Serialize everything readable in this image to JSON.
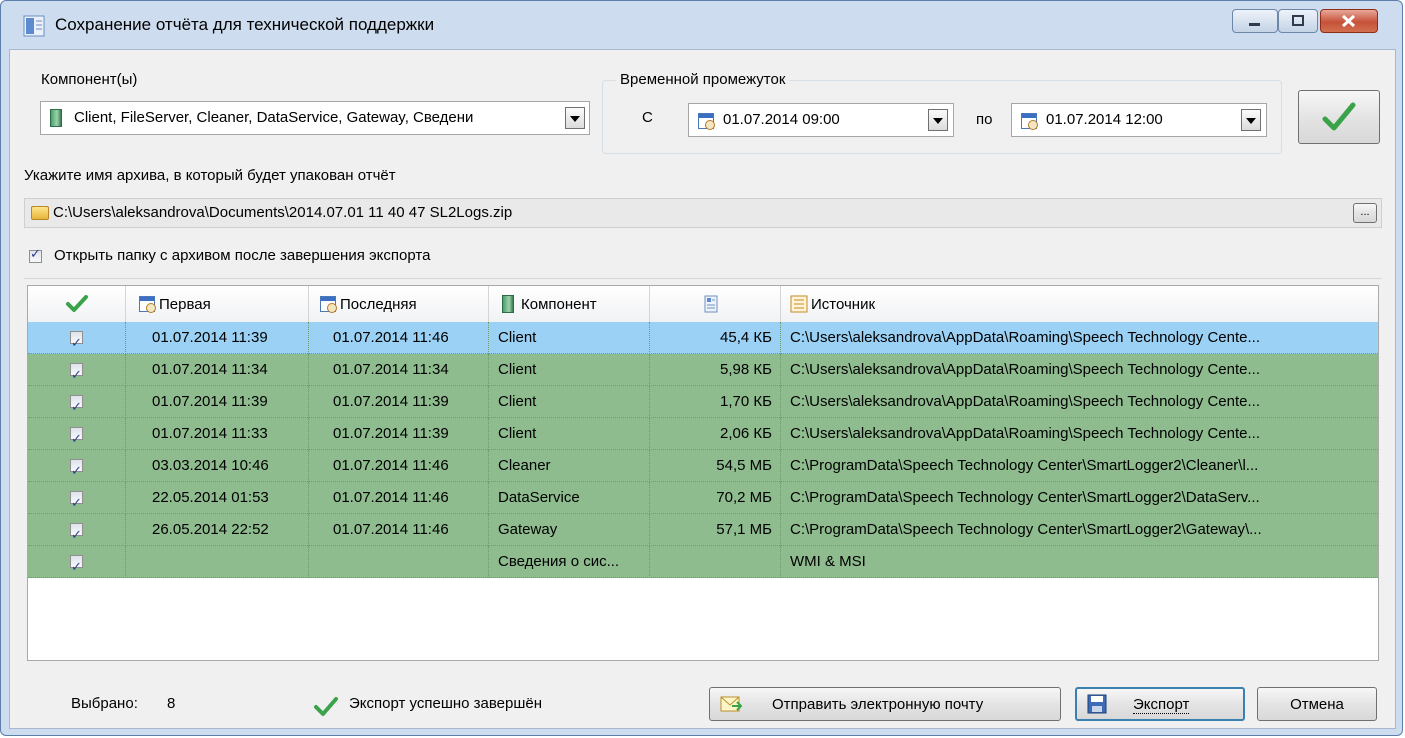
{
  "window": {
    "title": "Сохранение отчёта для технической поддержки"
  },
  "components": {
    "label": "Компонент(ы)",
    "value": "Client, FileServer, Cleaner, DataService, Gateway, Сведени"
  },
  "time_range": {
    "group_label": "Временной промежуток",
    "from_label": "С",
    "from_value": "01.07.2014 09:00",
    "to_label": "по",
    "to_value": "01.07.2014 12:00"
  },
  "archive": {
    "label": "Укажите имя архива, в который будет упакован отчёт",
    "path": "C:\\Users\\aleksandrova\\Documents\\2014.07.01 11 40 47 SL2Logs.zip",
    "browse_label": "..."
  },
  "open_folder": {
    "label": "Открыть папку с архивом после завершения экспорта",
    "checked": true
  },
  "table": {
    "columns": [
      "",
      "Первая",
      "Последняя",
      "Компонент",
      "",
      "Источник"
    ],
    "rows": [
      {
        "first": "01.07.2014 11:39",
        "last": "01.07.2014 11:46",
        "component": "Client",
        "size": "45,4 КБ",
        "source": "C:\\Users\\aleksandrova\\AppData\\Roaming\\Speech Technology Cente...",
        "selected": true
      },
      {
        "first": "01.07.2014 11:34",
        "last": "01.07.2014 11:34",
        "component": "Client",
        "size": "5,98 КБ",
        "source": "C:\\Users\\aleksandrova\\AppData\\Roaming\\Speech Technology Cente..."
      },
      {
        "first": "01.07.2014 11:39",
        "last": "01.07.2014 11:39",
        "component": "Client",
        "size": "1,70 КБ",
        "source": "C:\\Users\\aleksandrova\\AppData\\Roaming\\Speech Technology Cente..."
      },
      {
        "first": "01.07.2014 11:33",
        "last": "01.07.2014 11:39",
        "component": "Client",
        "size": "2,06 КБ",
        "source": "C:\\Users\\aleksandrova\\AppData\\Roaming\\Speech Technology Cente..."
      },
      {
        "first": "03.03.2014 10:46",
        "last": "01.07.2014 11:46",
        "component": "Cleaner",
        "size": "54,5 МБ",
        "source": "C:\\ProgramData\\Speech Technology Center\\SmartLogger2\\Cleaner\\l..."
      },
      {
        "first": "22.05.2014 01:53",
        "last": "01.07.2014 11:46",
        "component": "DataService",
        "size": "70,2 МБ",
        "source": "C:\\ProgramData\\Speech Technology Center\\SmartLogger2\\DataServ..."
      },
      {
        "first": "26.05.2014 22:52",
        "last": "01.07.2014 11:46",
        "component": "Gateway",
        "size": "57,1 МБ",
        "source": "C:\\ProgramData\\Speech Technology Center\\SmartLogger2\\Gateway\\..."
      },
      {
        "first": "",
        "last": "",
        "component": "Сведения о сис...",
        "size": "",
        "source": "WMI & MSI"
      }
    ]
  },
  "footer": {
    "selected_label": "Выбрано:",
    "selected_count": "8",
    "status": "Экспорт успешно завершён",
    "email_button": "Отправить электронную почту",
    "export_button": "Экспорт",
    "cancel_button": "Отмена"
  },
  "colors": {
    "row_green": "#8fbc8f",
    "row_selected": "#9ad1f4",
    "check_green": "#3aa34a"
  }
}
